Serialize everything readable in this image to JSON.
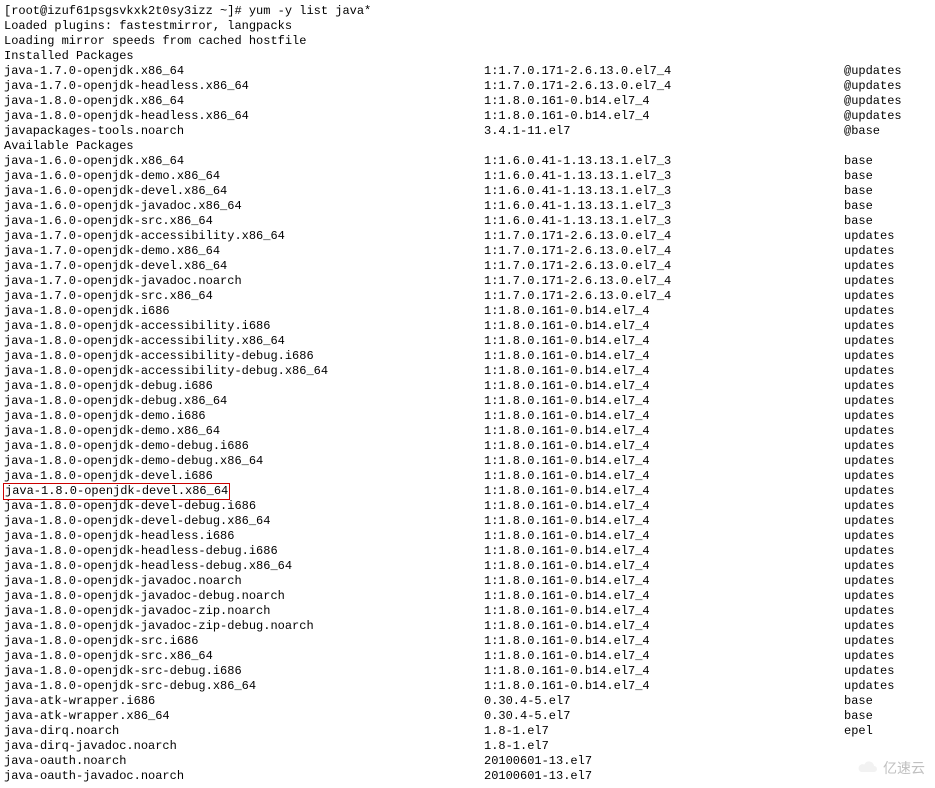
{
  "prompt": "[root@izuf61psgsvkxk2t0sy3izz ~]# yum -y list java*",
  "loaded_plugins": "Loaded plugins: fastestmirror, langpacks",
  "loading_mirror": "Loading mirror speeds from cached hostfile",
  "installed_header": "Installed Packages",
  "available_header": "Available Packages",
  "installed": [
    {
      "pkg": "java-1.7.0-openjdk.x86_64",
      "ver": "1:1.7.0.171-2.6.13.0.el7_4",
      "repo": "@updates"
    },
    {
      "pkg": "java-1.7.0-openjdk-headless.x86_64",
      "ver": "1:1.7.0.171-2.6.13.0.el7_4",
      "repo": "@updates"
    },
    {
      "pkg": "java-1.8.0-openjdk.x86_64",
      "ver": "1:1.8.0.161-0.b14.el7_4",
      "repo": "@updates"
    },
    {
      "pkg": "java-1.8.0-openjdk-headless.x86_64",
      "ver": "1:1.8.0.161-0.b14.el7_4",
      "repo": "@updates"
    },
    {
      "pkg": "javapackages-tools.noarch",
      "ver": "3.4.1-11.el7",
      "repo": "@base"
    }
  ],
  "available": [
    {
      "pkg": "java-1.6.0-openjdk.x86_64",
      "ver": "1:1.6.0.41-1.13.13.1.el7_3",
      "repo": "base"
    },
    {
      "pkg": "java-1.6.0-openjdk-demo.x86_64",
      "ver": "1:1.6.0.41-1.13.13.1.el7_3",
      "repo": "base"
    },
    {
      "pkg": "java-1.6.0-openjdk-devel.x86_64",
      "ver": "1:1.6.0.41-1.13.13.1.el7_3",
      "repo": "base"
    },
    {
      "pkg": "java-1.6.0-openjdk-javadoc.x86_64",
      "ver": "1:1.6.0.41-1.13.13.1.el7_3",
      "repo": "base"
    },
    {
      "pkg": "java-1.6.0-openjdk-src.x86_64",
      "ver": "1:1.6.0.41-1.13.13.1.el7_3",
      "repo": "base"
    },
    {
      "pkg": "java-1.7.0-openjdk-accessibility.x86_64",
      "ver": "1:1.7.0.171-2.6.13.0.el7_4",
      "repo": "updates"
    },
    {
      "pkg": "java-1.7.0-openjdk-demo.x86_64",
      "ver": "1:1.7.0.171-2.6.13.0.el7_4",
      "repo": "updates"
    },
    {
      "pkg": "java-1.7.0-openjdk-devel.x86_64",
      "ver": "1:1.7.0.171-2.6.13.0.el7_4",
      "repo": "updates"
    },
    {
      "pkg": "java-1.7.0-openjdk-javadoc.noarch",
      "ver": "1:1.7.0.171-2.6.13.0.el7_4",
      "repo": "updates"
    },
    {
      "pkg": "java-1.7.0-openjdk-src.x86_64",
      "ver": "1:1.7.0.171-2.6.13.0.el7_4",
      "repo": "updates"
    },
    {
      "pkg": "java-1.8.0-openjdk.i686",
      "ver": "1:1.8.0.161-0.b14.el7_4",
      "repo": "updates"
    },
    {
      "pkg": "java-1.8.0-openjdk-accessibility.i686",
      "ver": "1:1.8.0.161-0.b14.el7_4",
      "repo": "updates"
    },
    {
      "pkg": "java-1.8.0-openjdk-accessibility.x86_64",
      "ver": "1:1.8.0.161-0.b14.el7_4",
      "repo": "updates"
    },
    {
      "pkg": "java-1.8.0-openjdk-accessibility-debug.i686",
      "ver": "1:1.8.0.161-0.b14.el7_4",
      "repo": "updates"
    },
    {
      "pkg": "java-1.8.0-openjdk-accessibility-debug.x86_64",
      "ver": "1:1.8.0.161-0.b14.el7_4",
      "repo": "updates"
    },
    {
      "pkg": "java-1.8.0-openjdk-debug.i686",
      "ver": "1:1.8.0.161-0.b14.el7_4",
      "repo": "updates"
    },
    {
      "pkg": "java-1.8.0-openjdk-debug.x86_64",
      "ver": "1:1.8.0.161-0.b14.el7_4",
      "repo": "updates"
    },
    {
      "pkg": "java-1.8.0-openjdk-demo.i686",
      "ver": "1:1.8.0.161-0.b14.el7_4",
      "repo": "updates"
    },
    {
      "pkg": "java-1.8.0-openjdk-demo.x86_64",
      "ver": "1:1.8.0.161-0.b14.el7_4",
      "repo": "updates"
    },
    {
      "pkg": "java-1.8.0-openjdk-demo-debug.i686",
      "ver": "1:1.8.0.161-0.b14.el7_4",
      "repo": "updates"
    },
    {
      "pkg": "java-1.8.0-openjdk-demo-debug.x86_64",
      "ver": "1:1.8.0.161-0.b14.el7_4",
      "repo": "updates"
    },
    {
      "pkg": "java-1.8.0-openjdk-devel.i686",
      "ver": "1:1.8.0.161-0.b14.el7_4",
      "repo": "updates"
    },
    {
      "pkg": "java-1.8.0-openjdk-devel.x86_64",
      "ver": "1:1.8.0.161-0.b14.el7_4",
      "repo": "updates",
      "highlight": true
    },
    {
      "pkg": "java-1.8.0-openjdk-devel-debug.i686",
      "ver": "1:1.8.0.161-0.b14.el7_4",
      "repo": "updates"
    },
    {
      "pkg": "java-1.8.0-openjdk-devel-debug.x86_64",
      "ver": "1:1.8.0.161-0.b14.el7_4",
      "repo": "updates"
    },
    {
      "pkg": "java-1.8.0-openjdk-headless.i686",
      "ver": "1:1.8.0.161-0.b14.el7_4",
      "repo": "updates"
    },
    {
      "pkg": "java-1.8.0-openjdk-headless-debug.i686",
      "ver": "1:1.8.0.161-0.b14.el7_4",
      "repo": "updates"
    },
    {
      "pkg": "java-1.8.0-openjdk-headless-debug.x86_64",
      "ver": "1:1.8.0.161-0.b14.el7_4",
      "repo": "updates"
    },
    {
      "pkg": "java-1.8.0-openjdk-javadoc.noarch",
      "ver": "1:1.8.0.161-0.b14.el7_4",
      "repo": "updates"
    },
    {
      "pkg": "java-1.8.0-openjdk-javadoc-debug.noarch",
      "ver": "1:1.8.0.161-0.b14.el7_4",
      "repo": "updates"
    },
    {
      "pkg": "java-1.8.0-openjdk-javadoc-zip.noarch",
      "ver": "1:1.8.0.161-0.b14.el7_4",
      "repo": "updates"
    },
    {
      "pkg": "java-1.8.0-openjdk-javadoc-zip-debug.noarch",
      "ver": "1:1.8.0.161-0.b14.el7_4",
      "repo": "updates"
    },
    {
      "pkg": "java-1.8.0-openjdk-src.i686",
      "ver": "1:1.8.0.161-0.b14.el7_4",
      "repo": "updates"
    },
    {
      "pkg": "java-1.8.0-openjdk-src.x86_64",
      "ver": "1:1.8.0.161-0.b14.el7_4",
      "repo": "updates"
    },
    {
      "pkg": "java-1.8.0-openjdk-src-debug.i686",
      "ver": "1:1.8.0.161-0.b14.el7_4",
      "repo": "updates"
    },
    {
      "pkg": "java-1.8.0-openjdk-src-debug.x86_64",
      "ver": "1:1.8.0.161-0.b14.el7_4",
      "repo": "updates"
    },
    {
      "pkg": "java-atk-wrapper.i686",
      "ver": "0.30.4-5.el7",
      "repo": "base"
    },
    {
      "pkg": "java-atk-wrapper.x86_64",
      "ver": "0.30.4-5.el7",
      "repo": "base"
    },
    {
      "pkg": "java-dirq.noarch",
      "ver": "1.8-1.el7",
      "repo": "epel"
    },
    {
      "pkg": "java-dirq-javadoc.noarch",
      "ver": "1.8-1.el7",
      "repo": ""
    },
    {
      "pkg": "java-oauth.noarch",
      "ver": "20100601-13.el7",
      "repo": ""
    },
    {
      "pkg": "java-oauth-javadoc.noarch",
      "ver": "20100601-13.el7",
      "repo": ""
    }
  ],
  "watermark": "亿速云"
}
